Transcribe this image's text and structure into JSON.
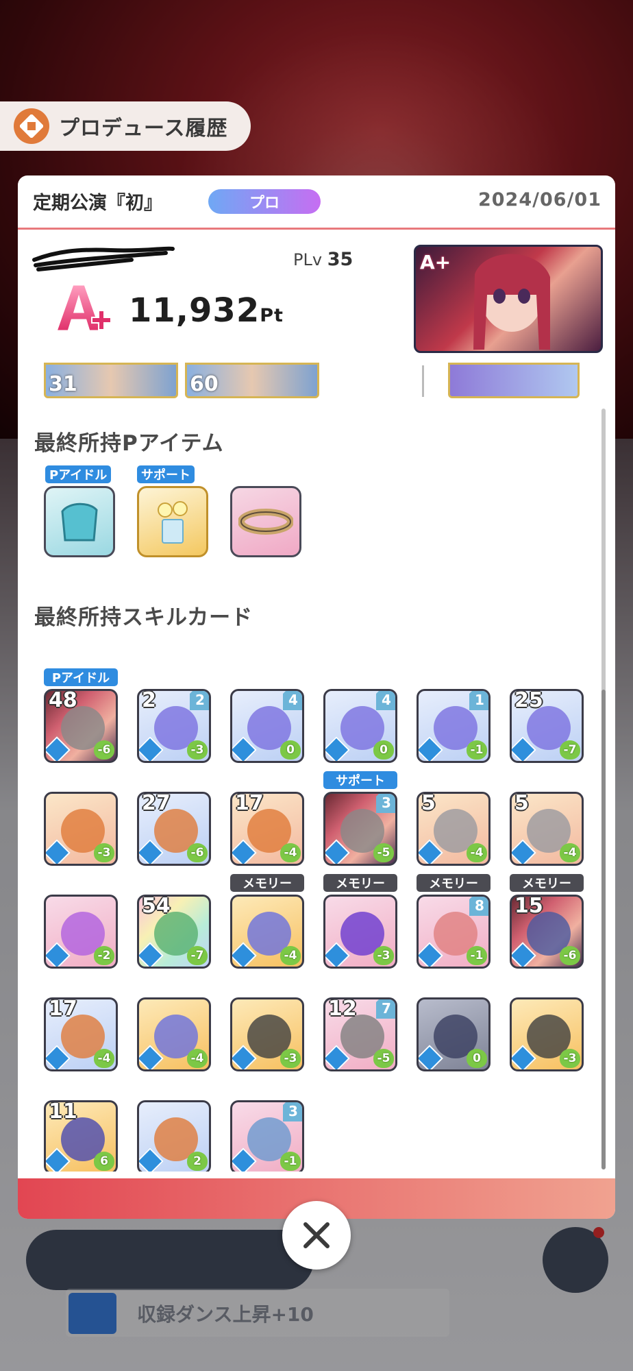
{
  "header": {
    "title": "プロデュース履歴",
    "icon": "history-book-icon"
  },
  "record": {
    "event_name": "定期公演『初』",
    "difficulty_badge": "プロ",
    "date": "2024/06/01",
    "plv_label": "PLv",
    "plv_value": "35",
    "grade": "A+",
    "score": "11,932",
    "score_unit": "Pt"
  },
  "top_cards": [
    {
      "label": "31"
    },
    {
      "label": "60"
    }
  ],
  "items_section": {
    "title": "最終所持Pアイテム",
    "items": [
      {
        "tag": "Pアイドル",
        "icon": "towel-icon"
      },
      {
        "tag": "サポート",
        "icon": "flower-vase-icon"
      },
      {
        "tag": "",
        "icon": "wristband-icon"
      }
    ]
  },
  "skills_section": {
    "title": "最終所持スキルカード",
    "cards": [
      {
        "tag": "Pアイドル",
        "level": "48",
        "cost": "",
        "heart": "-6",
        "icon": "idol-card-icon"
      },
      {
        "tag": "",
        "level": "2",
        "cost": "2",
        "heart": "-3",
        "icon": "jump-rope-icon"
      },
      {
        "tag": "",
        "level": "",
        "cost": "4",
        "heart": "0",
        "icon": "lightbulb-icon"
      },
      {
        "tag": "",
        "level": "",
        "cost": "4",
        "heart": "0",
        "icon": "lightbulb-icon"
      },
      {
        "tag": "",
        "level": "",
        "cost": "1",
        "heart": "-1",
        "icon": "wings-icon"
      },
      {
        "tag": "",
        "level": "25",
        "cost": "",
        "heart": "-7",
        "icon": "fist-icon"
      },
      {
        "tag": "",
        "level": "",
        "cost": "",
        "heart": "-3",
        "icon": "heart-hand-icon"
      },
      {
        "tag": "",
        "level": "27",
        "cost": "",
        "heart": "-6",
        "icon": "microphone-icon"
      },
      {
        "tag": "",
        "level": "17",
        "cost": "",
        "heart": "-4",
        "icon": "crown-hand-icon"
      },
      {
        "tag": "サポート",
        "level": "",
        "cost": "3",
        "heart": "-5",
        "icon": "support-photo-icon"
      },
      {
        "tag": "",
        "level": "5",
        "cost": "",
        "heart": "-4",
        "icon": "swirl-icon"
      },
      {
        "tag": "",
        "level": "5",
        "cost": "",
        "heart": "-4",
        "icon": "swirl-icon"
      },
      {
        "tag": "",
        "level": "",
        "cost": "",
        "heart": "-2",
        "icon": "star-burst-icon"
      },
      {
        "tag": "",
        "level": "54",
        "cost": "",
        "heart": "-7",
        "icon": "chat-bubble-icon"
      },
      {
        "tag": "メモリー",
        "level": "",
        "cost": "",
        "heart": "-4",
        "icon": "sparkle-icon"
      },
      {
        "tag": "メモリー",
        "level": "",
        "cost": "",
        "heart": "-3",
        "icon": "crescent-icon"
      },
      {
        "tag": "メモリー",
        "level": "",
        "cost": "8",
        "heart": "-1",
        "icon": "memory-stripe-icon"
      },
      {
        "tag": "メモリー",
        "level": "15",
        "cost": "",
        "heart": "-6",
        "icon": "memory-hands-icon"
      },
      {
        "tag": "",
        "level": "17",
        "cost": "",
        "heart": "-4",
        "icon": "crown-hand-icon"
      },
      {
        "tag": "",
        "level": "",
        "cost": "",
        "heart": "-4",
        "icon": "sparkle-icon"
      },
      {
        "tag": "",
        "level": "",
        "cost": "",
        "heart": "-3",
        "icon": "eye-icon"
      },
      {
        "tag": "",
        "level": "12",
        "cost": "7",
        "heart": "-5",
        "icon": "shoes-icon"
      },
      {
        "tag": "",
        "level": "",
        "cost": "",
        "heart": "0",
        "icon": "sleep-icon"
      },
      {
        "tag": "",
        "level": "",
        "cost": "",
        "heart": "-3",
        "icon": "eye-icon"
      },
      {
        "tag": "",
        "level": "11",
        "cost": "",
        "heart": "6",
        "icon": "legs-icon"
      },
      {
        "tag": "",
        "level": "",
        "cost": "",
        "heart": "2",
        "icon": "music-note-icon"
      },
      {
        "tag": "",
        "level": "",
        "cost": "3",
        "heart": "-1",
        "icon": "poster-icon"
      }
    ]
  },
  "bottom": {
    "mission_text": "収録ダンス上昇+10"
  },
  "colors": {
    "accent_pink": "#e24652",
    "badge_gradient_start": "#6fa8f4",
    "badge_gradient_end": "#c66ef2",
    "tag_blue": "#2f8ce0",
    "tag_dark": "#4b4b52",
    "heart_green": "#7cc846"
  }
}
